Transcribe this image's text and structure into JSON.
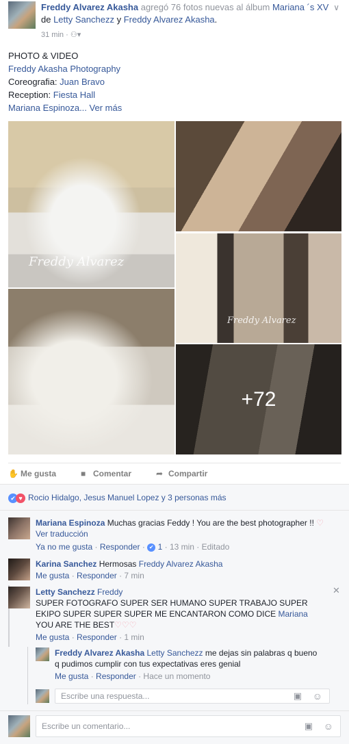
{
  "post": {
    "author": "Freddy Alvarez Akasha",
    "action": " agregó 76 fotos nuevas al álbum ",
    "album": "Mariana ´s XV",
    "de": " de ",
    "tagged1": "Letty Sanchezz",
    "y": " y ",
    "tagged2": "Freddy Alvarez Akasha",
    "period": ".",
    "time": "31 min",
    "audience_sep": "·",
    "lines": {
      "l1": "PHOTO & VIDEO",
      "l2": "Freddy Akasha Photography",
      "l3_label": "Coreografia: ",
      "l3_value": "Juan Bravo",
      "l4_label": "Reception: ",
      "l4_value": "Fiesta Hall",
      "l5_value": "Mariana Espinoza",
      "l5_more": "... Ver más"
    },
    "more_photos": "+72",
    "watermark": "Freddy Alvarez"
  },
  "actions": {
    "like": "Me gusta",
    "comment": "Comentar",
    "share": "Compartir"
  },
  "reactions": {
    "text": "Rocio Hidalgo, Jesus Manuel Lopez y 3 personas más"
  },
  "comments": [
    {
      "name": "Mariana Espinoza",
      "text": " Muchas gracias Feddy ! You are the best photographer !! ",
      "translate": "Ver traducción",
      "unlike": "Ya no me gusta",
      "reply": "Responder",
      "likes": "1",
      "time": "13 min",
      "edited": "Editado"
    },
    {
      "name": "Karina Sanchez",
      "text": " Hermosas ",
      "mention": "Freddy Alvarez Akasha",
      "like": "Me gusta",
      "reply": "Responder",
      "time": "7 min"
    },
    {
      "name": "Letty Sanchezz",
      "mention": " Freddy",
      "text1": "SUPER FOTOGRAFO SUPER SER HUMANO SUPER TRABAJO SUPER",
      "text2": "EKIPO SUPER SUPER SUPER ME ENCANTARON COMO DICE ",
      "mention2": "Mariana",
      "text3": "YOU ARE THE BEST",
      "like": "Me gusta",
      "reply": "Responder",
      "time": "1 min"
    }
  ],
  "reply": {
    "name": "Freddy Alvarez Akasha",
    "mention": " Letty Sanchezz",
    "text1": " me dejas sin palabras q bueno",
    "text2": "q pudimos cumplir con tus expectativas eres genial",
    "like": "Me gusta",
    "reply": "Responder",
    "time": "Hace un momento"
  },
  "reply_input": {
    "placeholder": "Escribe una respuesta..."
  },
  "comment_input": {
    "placeholder": "Escribe un comentario..."
  },
  "icons": {
    "like": "thumbs-up-icon",
    "comment": "speech-bubble-icon",
    "share": "share-arrow-icon",
    "camera": "camera-icon",
    "emoji": "smiley-icon",
    "close": "close-icon",
    "chevron": "chevron-down-icon",
    "audience": "friends-icon"
  },
  "colors": {
    "link": "#365899",
    "meta": "#90949c",
    "comment_bg": "#f6f7f9",
    "like_blue": "#5890ff",
    "heart_red": "#f25268"
  }
}
